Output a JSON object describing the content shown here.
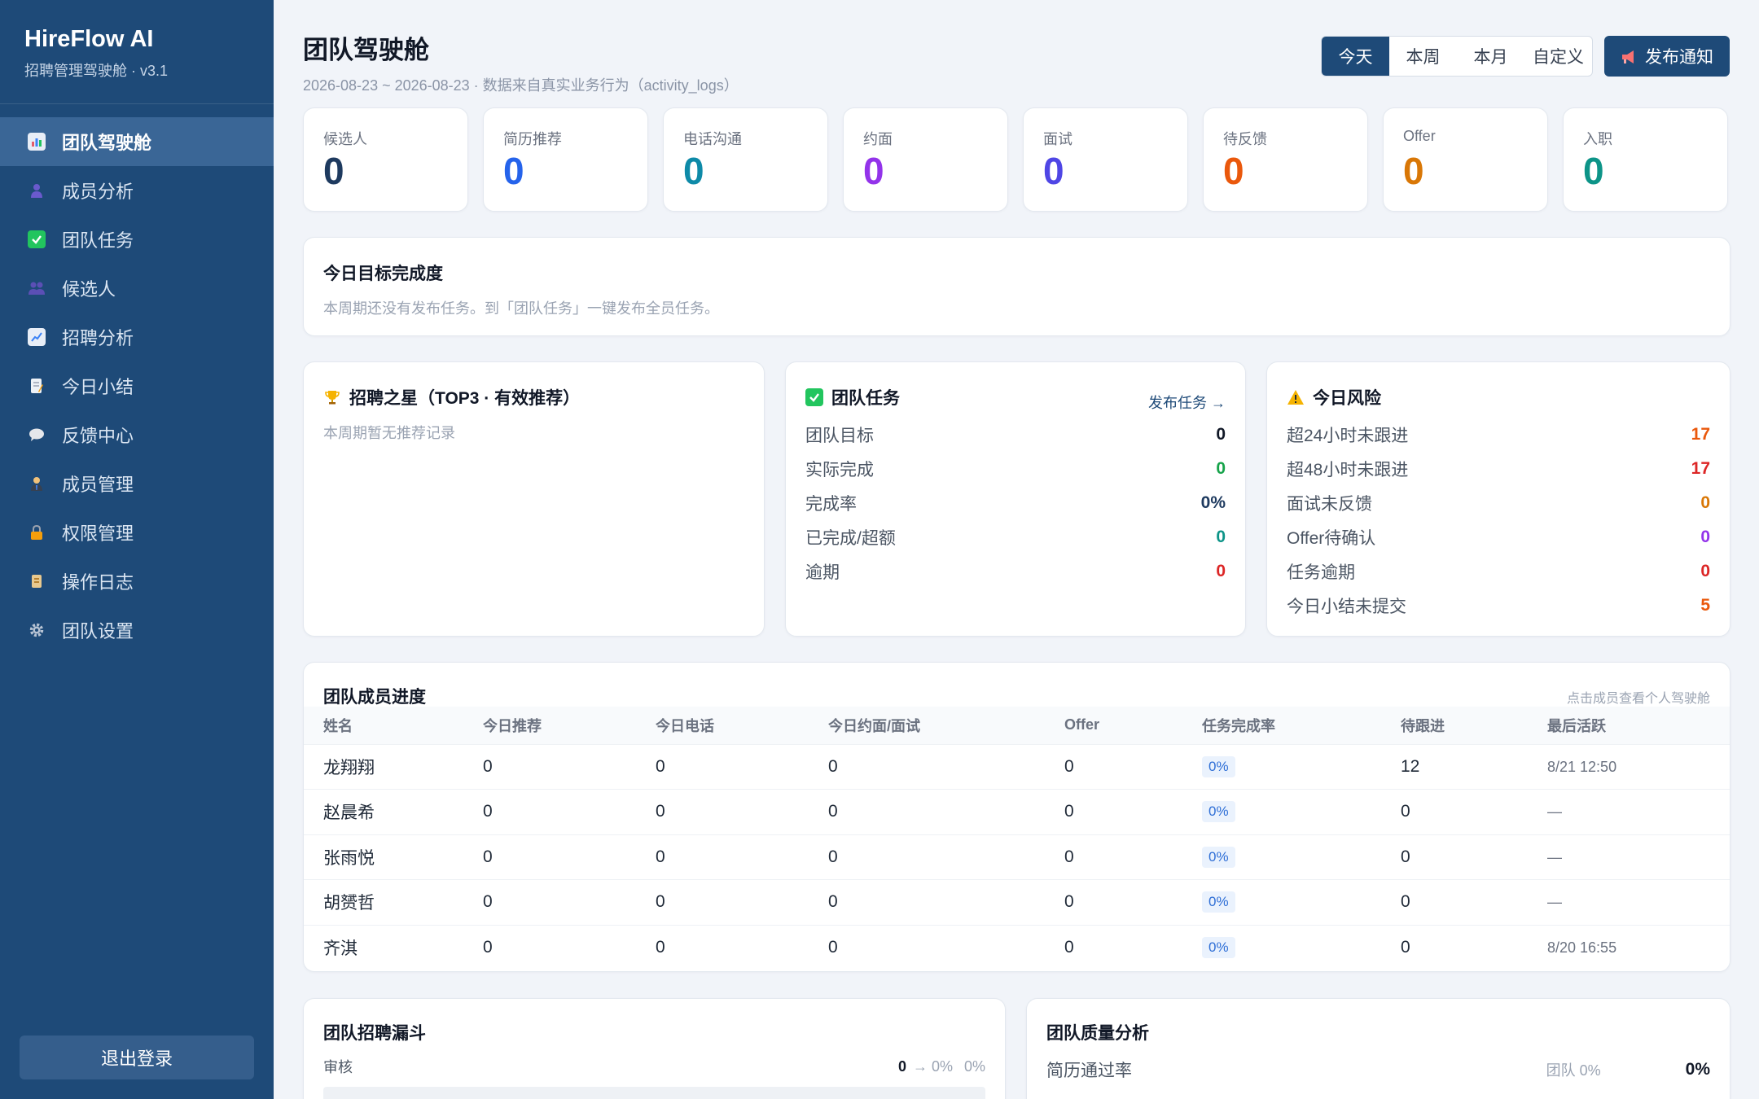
{
  "app": {
    "name": "HireFlow AI",
    "subtitle": "招聘管理驾驶舱 · v3.1"
  },
  "sidebar": {
    "items": [
      {
        "label": "团队驾驶舱",
        "icon": "bar-chart-icon",
        "active": true
      },
      {
        "label": "成员分析",
        "icon": "person-icon"
      },
      {
        "label": "团队任务",
        "icon": "check-box-icon"
      },
      {
        "label": "候选人",
        "icon": "people-icon"
      },
      {
        "label": "招聘分析",
        "icon": "line-chart-icon"
      },
      {
        "label": "今日小结",
        "icon": "memo-icon"
      },
      {
        "label": "反馈中心",
        "icon": "speech-bubble-icon"
      },
      {
        "label": "成员管理",
        "icon": "person-tie-icon"
      },
      {
        "label": "权限管理",
        "icon": "lock-icon"
      },
      {
        "label": "操作日志",
        "icon": "scroll-icon"
      },
      {
        "label": "团队设置",
        "icon": "gear-icon"
      }
    ],
    "logout_label": "退出登录"
  },
  "header": {
    "title": "团队驾驶舱",
    "subtitle": "2026-08-23 ~ 2026-08-23 · 数据来自真实业务行为（activity_logs）",
    "ranges": [
      "今天",
      "本周",
      "本月",
      "自定义"
    ],
    "active_range": "今天",
    "publish_label": "发布通知"
  },
  "stats": [
    {
      "label": "候选人",
      "value": "0",
      "color": "#1e3a5f"
    },
    {
      "label": "简历推荐",
      "value": "0",
      "color": "#2563eb"
    },
    {
      "label": "电话沟通",
      "value": "0",
      "color": "#0e8aa8"
    },
    {
      "label": "约面",
      "value": "0",
      "color": "#9333ea"
    },
    {
      "label": "面试",
      "value": "0",
      "color": "#4f46e5"
    },
    {
      "label": "待反馈",
      "value": "0",
      "color": "#ea580c"
    },
    {
      "label": "Offer",
      "value": "0",
      "color": "#d97706"
    },
    {
      "label": "入职",
      "value": "0",
      "color": "#0d9488"
    }
  ],
  "goal": {
    "title": "今日目标完成度",
    "empty_text": "本周期还没有发布任务。到「团队任务」一键发布全员任务。"
  },
  "stars": {
    "title": "招聘之星（TOP3 · 有效推荐）",
    "empty_text": "本周期暂无推荐记录"
  },
  "team_tasks": {
    "title": "团队任务",
    "link_label": "发布任务 →",
    "rows": [
      {
        "label": "团队目标",
        "value": "0",
        "color": "#111827"
      },
      {
        "label": "实际完成",
        "value": "0",
        "color": "#16a34a"
      },
      {
        "label": "完成率",
        "value": "0%",
        "color": "#1e3a5f"
      },
      {
        "label": "已完成/超额",
        "value": "0",
        "color": "#0d9488"
      },
      {
        "label": "逾期",
        "value": "0",
        "color": "#dc2626"
      }
    ]
  },
  "risks": {
    "title": "今日风险",
    "rows": [
      {
        "label": "超24小时未跟进",
        "value": "17",
        "color": "#ea580c"
      },
      {
        "label": "超48小时未跟进",
        "value": "17",
        "color": "#dc2626"
      },
      {
        "label": "面试未反馈",
        "value": "0",
        "color": "#d97706"
      },
      {
        "label": "Offer待确认",
        "value": "0",
        "color": "#9333ea"
      },
      {
        "label": "任务逾期",
        "value": "0",
        "color": "#dc2626"
      },
      {
        "label": "今日小结未提交",
        "value": "5",
        "color": "#ea580c"
      }
    ]
  },
  "members": {
    "title": "团队成员进度",
    "hint": "点击成员查看个人驾驶舱",
    "columns": [
      "姓名",
      "今日推荐",
      "今日电话",
      "今日约面/面试",
      "Offer",
      "任务完成率",
      "待跟进",
      "最后活跃"
    ],
    "rows": [
      {
        "name": "龙翔翔",
        "rec": "0",
        "call": "0",
        "interview": "0",
        "offer": "0",
        "rate": "0%",
        "pending": "12",
        "last": "8/21 12:50"
      },
      {
        "name": "赵晨希",
        "rec": "0",
        "call": "0",
        "interview": "0",
        "offer": "0",
        "rate": "0%",
        "pending": "0",
        "last": "—"
      },
      {
        "name": "张雨悦",
        "rec": "0",
        "call": "0",
        "interview": "0",
        "offer": "0",
        "rate": "0%",
        "pending": "0",
        "last": "—"
      },
      {
        "name": "胡赟哲",
        "rec": "0",
        "call": "0",
        "interview": "0",
        "offer": "0",
        "rate": "0%",
        "pending": "0",
        "last": "—"
      },
      {
        "name": "齐淇",
        "rec": "0",
        "call": "0",
        "interview": "0",
        "offer": "0",
        "rate": "0%",
        "pending": "0",
        "last": "8/20 16:55"
      }
    ]
  },
  "funnel": {
    "title": "团队招聘漏斗",
    "rows": [
      {
        "label": "审核",
        "value": "0",
        "arrow": "→ 0%",
        "pct": "0%",
        "fill": 0
      }
    ]
  },
  "quality": {
    "title": "团队质量分析",
    "rows": [
      {
        "label": "简历通过率",
        "team": "团队 0%",
        "value": "0%"
      }
    ]
  }
}
